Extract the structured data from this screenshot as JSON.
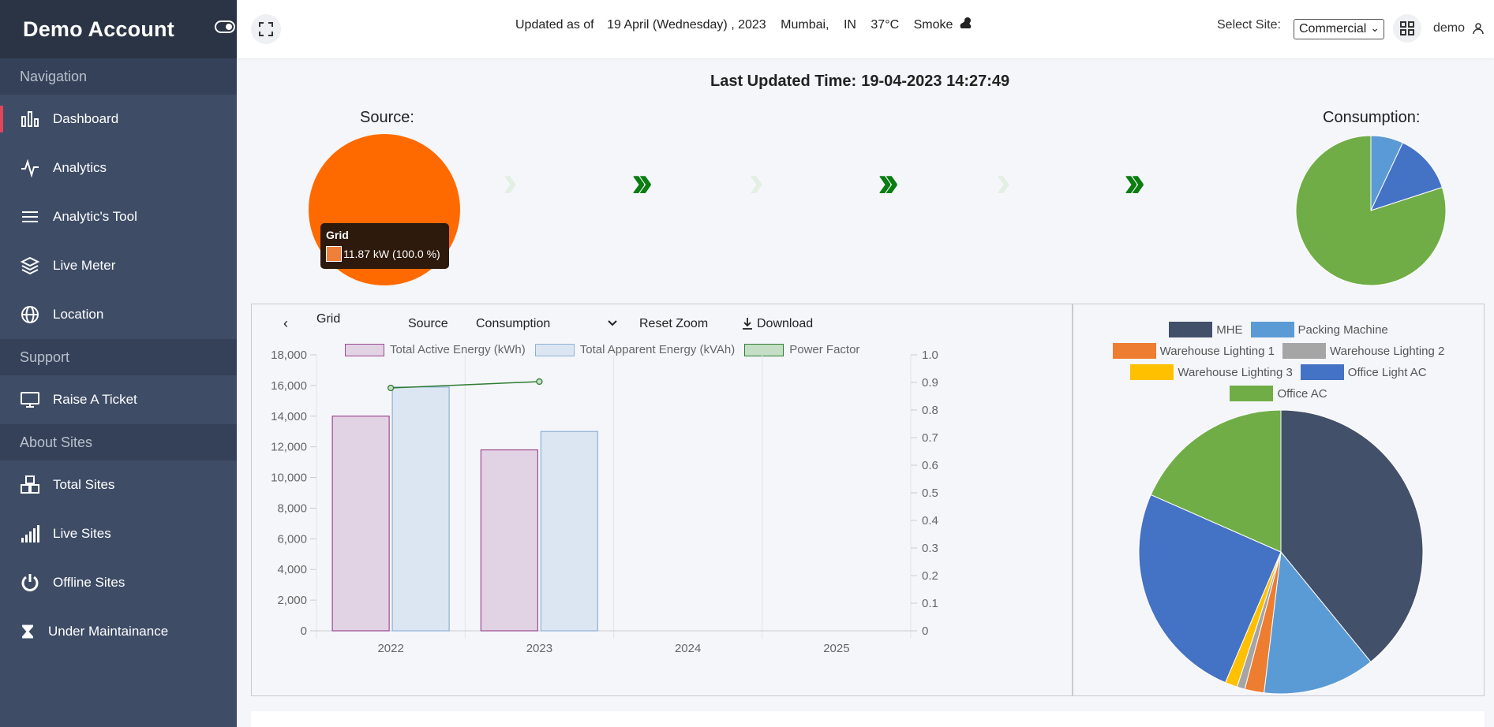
{
  "sidebar": {
    "brand": "Demo Account",
    "sections": [
      {
        "title": "Navigation",
        "items": [
          {
            "label": "Dashboard",
            "icon": "bar-chart-icon",
            "active": true
          },
          {
            "label": "Analytics",
            "icon": "activity-icon"
          },
          {
            "label": "Analytic's Tool",
            "icon": "menu-icon"
          },
          {
            "label": "Live Meter",
            "icon": "layers-icon"
          },
          {
            "label": "Location",
            "icon": "globe-icon"
          }
        ]
      },
      {
        "title": "Support",
        "items": [
          {
            "label": "Raise A Ticket",
            "icon": "monitor-icon"
          }
        ]
      },
      {
        "title": "About Sites",
        "items": [
          {
            "label": "Total Sites",
            "icon": "cubes-icon"
          },
          {
            "label": "Live Sites",
            "icon": "signal-icon"
          },
          {
            "label": "Offline Sites",
            "icon": "power-icon"
          },
          {
            "label": "Under Maintainance",
            "icon": "hourglass-icon"
          }
        ]
      }
    ]
  },
  "topbar": {
    "updated_prefix": "Updated as of",
    "date": "19 April (Wednesday) , 2023",
    "city": "Mumbai,",
    "country": "IN",
    "temperature": "37°C",
    "condition": "Smoke",
    "select_site_label": "Select Site:",
    "selected_site": "Commercial",
    "user": "demo"
  },
  "main": {
    "last_updated_label": "Last Updated Time:",
    "last_updated_value": "19-04-2023 14:27:49",
    "source_label": "Source:",
    "consumption_label": "Consumption:",
    "tooltip": {
      "title": "Grid",
      "value": "11.87 kW (100.0 %)"
    }
  },
  "toolbar": {
    "back": "‹",
    "tabs": [
      "Grid",
      "Source",
      "Consumption"
    ],
    "reset_zoom": "Reset Zoom",
    "download": "Download"
  },
  "colors": {
    "sidebar": "#3e4c66",
    "grid_orange": "#ff6a00",
    "arrow_green": "#0b7d11",
    "active_energy": "#e2d3e4",
    "apparent_energy": "#dce6f2",
    "power_factor": "#2e7d32"
  },
  "chart_data": [
    {
      "type": "bar",
      "categories": [
        "2022",
        "2023",
        "2024",
        "2025"
      ],
      "series": [
        {
          "name": "Total Active Energy (kWh)",
          "values": [
            14000,
            11800,
            null,
            null
          ]
        },
        {
          "name": "Total Apparent Energy (kVAh)",
          "values": [
            15900,
            13000,
            null,
            null
          ]
        },
        {
          "name": "Power Factor",
          "type": "line",
          "axis": "right",
          "values": [
            0.88,
            0.903,
            null,
            null
          ]
        }
      ],
      "ylim": [
        0,
        18000
      ],
      "yticks": [
        "0",
        "2,000",
        "4,000",
        "6,000",
        "8,000",
        "10,000",
        "12,000",
        "14,000",
        "16,000",
        "18,000"
      ],
      "y2lim": [
        0,
        1.0
      ],
      "y2ticks": [
        "0",
        "0.1",
        "0.2",
        "0.3",
        "0.4",
        "0.5",
        "0.6",
        "0.7",
        "0.8",
        "0.9",
        "1.0"
      ],
      "legend": "top",
      "grid": "vertical"
    },
    {
      "type": "pie",
      "title": "Consumption:",
      "labels": [
        "MHE",
        "Packing Machine",
        "Warehouse Lighting 1",
        "Warehouse Lighting 2",
        "Warehouse Lighting 3",
        "Office Light AC",
        "Office AC"
      ],
      "values": [
        39.1,
        12.8,
        2.2,
        0.9,
        1.4,
        25.2,
        18.4
      ],
      "colors": [
        "#435069",
        "#5b9bd5",
        "#ed7d31",
        "#a5a5a5",
        "#ffc000",
        "#4472c4",
        "#70ad47"
      ],
      "legend": "top"
    },
    {
      "type": "pie",
      "title": "Consumption:",
      "labels": [
        "Packing Machine",
        "Office Light AC",
        "Office AC"
      ],
      "values": [
        7,
        13,
        80
      ],
      "colors": [
        "#5b9bd5",
        "#4472c4",
        "#70ad47"
      ]
    }
  ]
}
